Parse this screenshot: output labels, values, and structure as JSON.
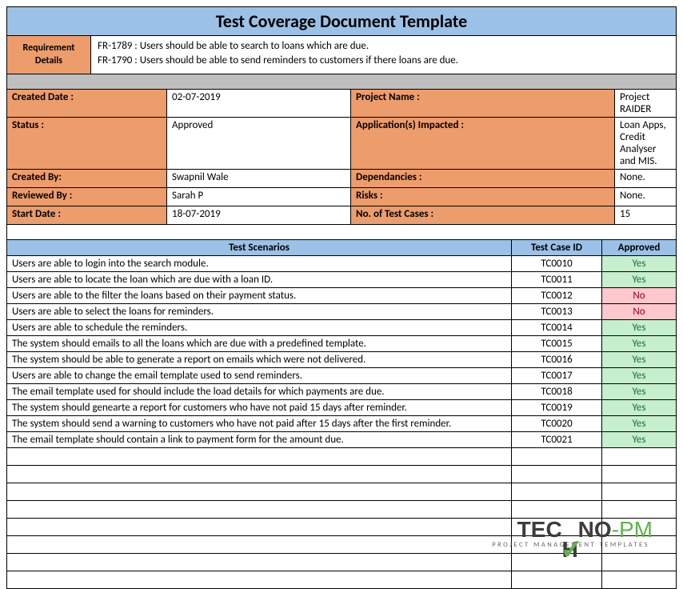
{
  "title": "Test Coverage Document Template",
  "requirement": {
    "label": "Requirement Details",
    "lines": [
      "FR-1789 : Users should be able to search to loans which are due.",
      "FR-1790 : Users should be able to send reminders to customers if there loans are due."
    ]
  },
  "meta": [
    {
      "l1": "Created Date :",
      "v1": "02-07-2019",
      "l2": "Project Name :",
      "v2": "Project RAIDER"
    },
    {
      "l1": "Status :",
      "v1": "Approved",
      "l2": "Application(s) Impacted :",
      "v2": "Loan Apps, Credit Analyser and MIS."
    },
    {
      "l1": "Created By:",
      "v1": "Swapnil Wale",
      "l2": "Dependancies :",
      "v2": "None."
    },
    {
      "l1": "Reviewed By :",
      "v1": "Sarah P",
      "l2": "Risks :",
      "v2": "None."
    },
    {
      "l1": "Start Date :",
      "v1": "18-07-2019",
      "l2": "No. of Test Cases :",
      "v2": "15"
    }
  ],
  "headers": {
    "scenario": "Test Scenarios",
    "tcid": "Test Case ID",
    "approved": "Approved"
  },
  "rows": [
    {
      "scenario": "Users are able to login into the search module.",
      "tcid": "TC0010",
      "approved": "Yes"
    },
    {
      "scenario": "Users are able to locate the loan which are due with a loan ID.",
      "tcid": "TC0011",
      "approved": "Yes"
    },
    {
      "scenario": "Users are able to the filter the loans based on their payment status.",
      "tcid": "TC0012",
      "approved": "No"
    },
    {
      "scenario": "Users are able to select the loans for reminders.",
      "tcid": "TC0013",
      "approved": "No"
    },
    {
      "scenario": "Users are able to schedule the reminders.",
      "tcid": "TC0014",
      "approved": "Yes"
    },
    {
      "scenario": "The system should emails to all the loans which are due with a predefined template.",
      "tcid": "TC0015",
      "approved": "Yes"
    },
    {
      "scenario": "The system should be able to generate a report on emails which were not delivered.",
      "tcid": "TC0016",
      "approved": "Yes"
    },
    {
      "scenario": "Users are able to change the email template used to send reminders.",
      "tcid": "TC0017",
      "approved": "Yes"
    },
    {
      "scenario": "The email template used for should include the load details for which payments are due.",
      "tcid": "TC0018",
      "approved": "Yes"
    },
    {
      "scenario": "The system should genearte a report for customers who have not paid 15 days after reminder.",
      "tcid": "TC0019",
      "approved": "Yes"
    },
    {
      "scenario": "The system should send a warning to customers who have not paid after 15 days after the first reminder.",
      "tcid": "TC0020",
      "approved": "Yes"
    },
    {
      "scenario": "The email template should contain a link to payment form for the amount due.",
      "tcid": "TC0021",
      "approved": "Yes"
    }
  ],
  "emptyRows": 8,
  "logo": {
    "main1": "TEC",
    "main2": "NO",
    "suffix": "-PM",
    "sub": "PROJECT MANAGEMENT TEMPLATES"
  }
}
